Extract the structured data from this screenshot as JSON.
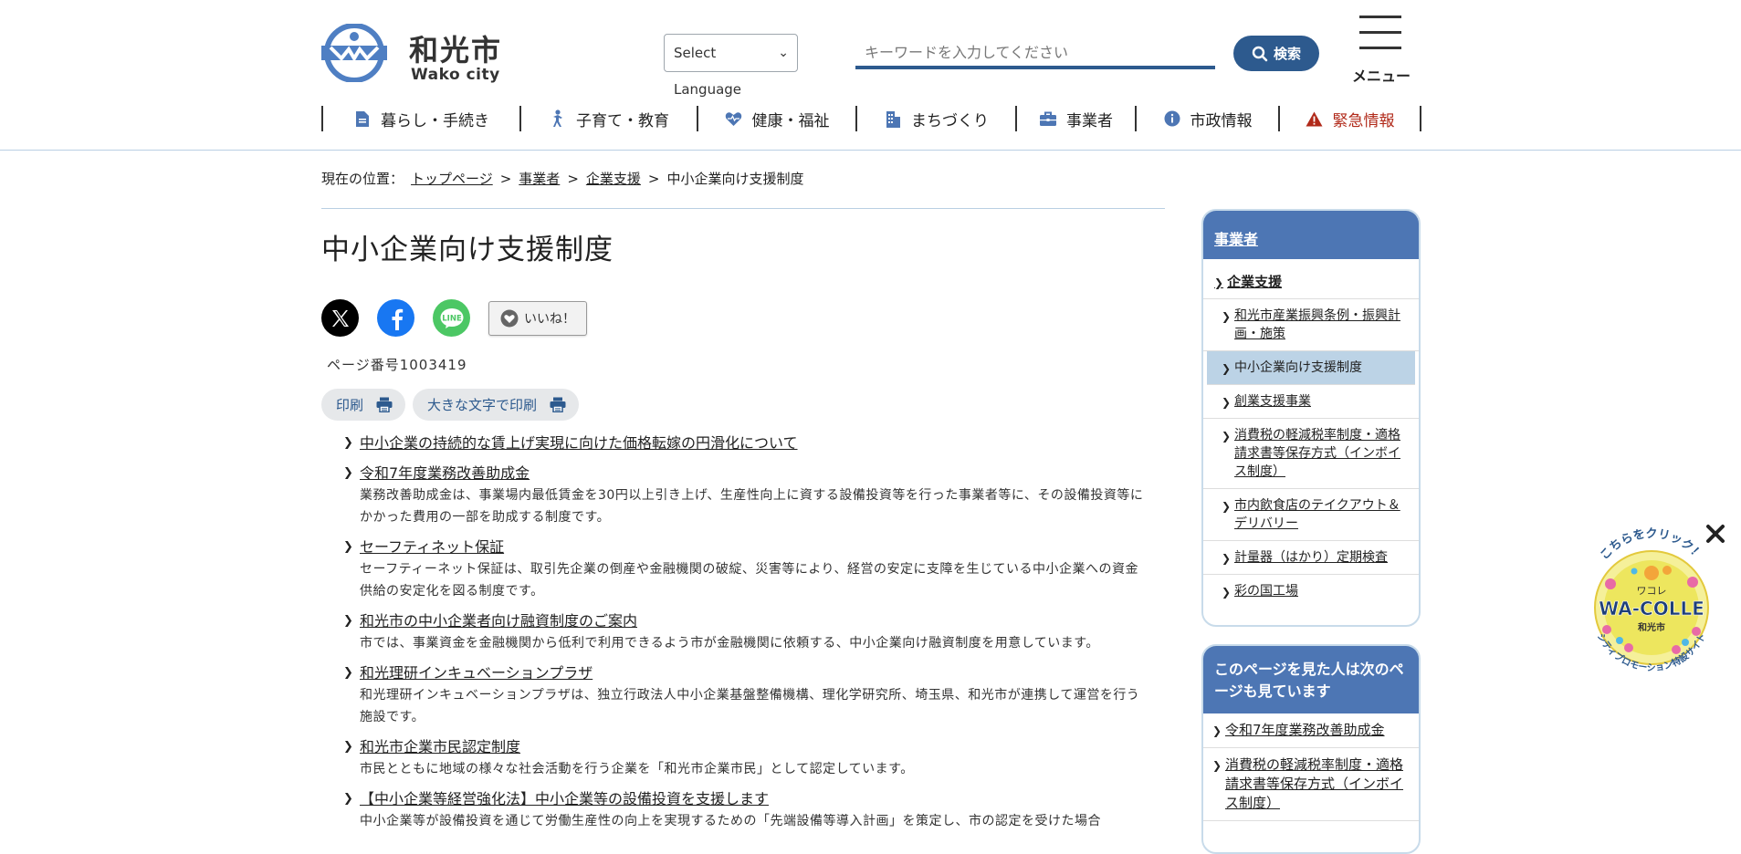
{
  "header": {
    "logo_ja": "和光市",
    "logo_en": "Wako city",
    "language_select": "Select Language",
    "search_placeholder": "キーワードを入力してください",
    "search_button": "検索",
    "menu_label": "メニュー"
  },
  "gnav": [
    {
      "label": "暮らし・手続き",
      "icon": "document-icon"
    },
    {
      "label": "子育て・教育",
      "icon": "child-icon"
    },
    {
      "label": "健康・福祉",
      "icon": "heart-icon"
    },
    {
      "label": "まちづくり",
      "icon": "building-icon"
    },
    {
      "label": "事業者",
      "icon": "briefcase-icon"
    },
    {
      "label": "市政情報",
      "icon": "info-icon"
    },
    {
      "label": "緊急情報",
      "icon": "warning-icon"
    }
  ],
  "breadcrumb": {
    "prefix": "現在の位置：",
    "items": [
      "トップページ",
      "事業者",
      "企業支援",
      "中小企業向け支援制度"
    ]
  },
  "page": {
    "title": "中小企業向け支援制度",
    "like_label": "いいね！",
    "page_number": "ページ番号1003419",
    "print_label": "印刷",
    "print_large_label": "大きな文字で印刷"
  },
  "items": [
    {
      "title": "中小企業の持続的な賃上げ実現に向けた価格転嫁の円滑化について",
      "desc": ""
    },
    {
      "title": "令和7年度業務改善助成金",
      "desc": "業務改善助成金は、事業場内最低賃金を30円以上引き上げ、生産性向上に資する設備投資等を行った事業者等に、その設備投資等にかかった費用の一部を助成する制度です。"
    },
    {
      "title": "セーフティネット保証",
      "desc": "セーフティーネット保証は、取引先企業の倒産や金融機関の破綻、災害等により、経営の安定に支障を生じている中小企業への資金供給の安定化を図る制度です。"
    },
    {
      "title": "和光市の中小企業者向け融資制度のご案内",
      "desc": "市では、事業資金を金融機関から低利で利用できるよう市が金融機関に依頼する、中小企業向け融資制度を用意しています。"
    },
    {
      "title": "和光理研インキュベーションプラザ",
      "desc": "和光理研インキュベーションプラザは、独立行政法人中小企業基盤整備機構、理化学研究所、埼玉県、和光市が連携して運営を行う施設です。"
    },
    {
      "title": "和光市企業市民認定制度",
      "desc": "市民とともに地域の様々な社会活動を行う企業を「和光市企業市民」として認定しています。"
    },
    {
      "title": "【中小企業等経営強化法】中小企業等の設備投資を支援します",
      "desc": "中小企業等が設備投資を通じて労働生産性の向上を実現するための「先端設備等導入計画」を策定し、市の認定を受けた場合"
    }
  ],
  "sidebar": {
    "heading": "事業者",
    "sub": "企業支援",
    "items": [
      "和光市産業振興条例・振興計画・施策",
      "中小企業向け支援制度",
      "創業支援事業",
      "消費税の軽減税率制度・適格請求書等保存方式（インボイス制度）",
      "市内飲食店のテイクアウト＆デリバリー",
      "計量器（はかり）定期検査",
      "彩の国工場"
    ],
    "current_index": 1
  },
  "related": {
    "heading": "このページを見た人は次のページも見ています",
    "items": [
      "令和7年度業務改善助成金",
      "消費税の軽減税率制度・適格請求書等保存方式（インボイス制度）"
    ]
  },
  "badge": {
    "top_text": "こちらをクリック！",
    "small_text": "ワコレ",
    "main_text": "WA-COLLE",
    "city_text": "和光市",
    "bottom_text": "シティプロモーション特設サイト"
  },
  "colors": {
    "brand_blue": "#2d5a8e",
    "sidebar_blue": "#4d76b4",
    "emergency_red": "#b12a1a",
    "current_bg": "#bcd3e6"
  }
}
